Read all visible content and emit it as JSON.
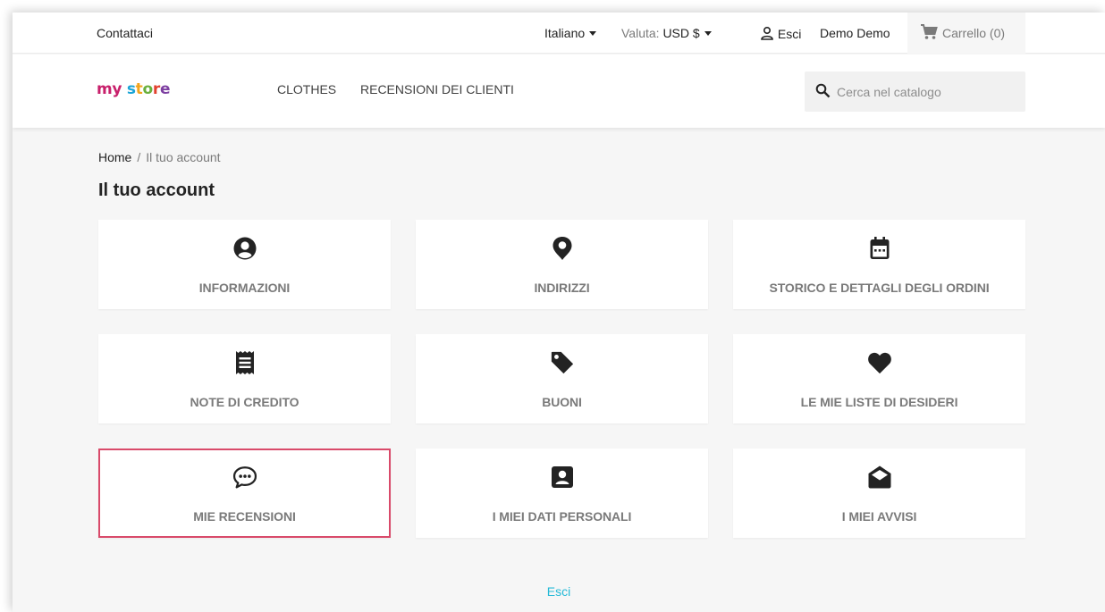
{
  "topbar": {
    "contact": "Contattaci",
    "language": "Italiano",
    "currency_label": "Valuta:",
    "currency_value": "USD $",
    "signout": "Esci",
    "user": "Demo Demo",
    "cart": "Carrello (0)"
  },
  "header": {
    "logo_parts": [
      "my",
      " ",
      "s",
      "t",
      "o",
      "r",
      "e"
    ],
    "logo_colors": [
      "#c8206b",
      "#c8206b",
      "#1ba4d6",
      "#f2a41d",
      "#6ab03c",
      "#e2412f",
      "#7d3fa1"
    ],
    "nav": [
      "Clothes",
      "Recensioni dei clienti"
    ],
    "search_placeholder": "Cerca nel catalogo"
  },
  "breadcrumb": {
    "home": "Home",
    "separator": "/",
    "current": "Il tuo account"
  },
  "page_title": "Il tuo account",
  "tiles": [
    {
      "label": "Informazioni",
      "icon": "user-circle-icon"
    },
    {
      "label": "Indirizzi",
      "icon": "map-pin-icon"
    },
    {
      "label": "Storico e dettagli degli ordini",
      "icon": "calendar-icon"
    },
    {
      "label": "Note di credito",
      "icon": "receipt-icon"
    },
    {
      "label": "Buoni",
      "icon": "tag-icon"
    },
    {
      "label": "Le mie liste di desideri",
      "icon": "heart-icon"
    },
    {
      "label": "Mie recensioni",
      "icon": "comment-icon"
    },
    {
      "label": "I miei dati personali",
      "icon": "contact-card-icon"
    },
    {
      "label": "I miei avvisi",
      "icon": "envelope-open-icon"
    }
  ],
  "active_tile": "Mie recensioni",
  "logout": "Esci",
  "colors": {
    "accent_link": "#24b9d7",
    "active_border": "#d94a6a",
    "icon": "#232323",
    "label": "#7a7a7a"
  }
}
